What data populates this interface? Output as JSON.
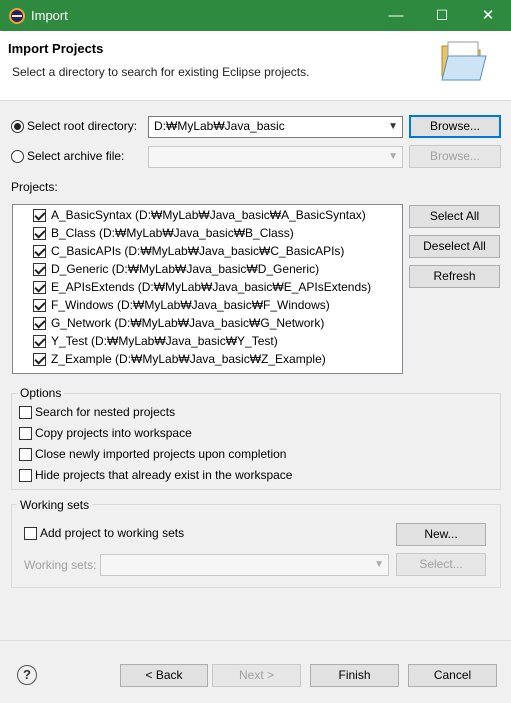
{
  "window": {
    "title": "Import",
    "controls": [
      "—",
      "☐",
      "✕"
    ]
  },
  "header": {
    "title": "Import Projects",
    "description": "Select a directory to search for existing Eclipse projects."
  },
  "source": {
    "root_label": "Select root directory:",
    "root_value": "D:₩MyLab₩Java_basic",
    "archive_label": "Select archive file:",
    "archive_value": "",
    "browse_label": "Browse...",
    "browse_archive_label": "Browse..."
  },
  "projects": {
    "label": "Projects:",
    "items": [
      "A_BasicSyntax (D:₩MyLab₩Java_basic₩A_BasicSyntax)",
      "B_Class (D:₩MyLab₩Java_basic₩B_Class)",
      "C_BasicAPIs (D:₩MyLab₩Java_basic₩C_BasicAPIs)",
      "D_Generic (D:₩MyLab₩Java_basic₩D_Generic)",
      "E_APIsExtends (D:₩MyLab₩Java_basic₩E_APIsExtends)",
      "F_Windows (D:₩MyLab₩Java_basic₩F_Windows)",
      "G_Network (D:₩MyLab₩Java_basic₩G_Network)",
      "Y_Test (D:₩MyLab₩Java_basic₩Y_Test)",
      "Z_Example (D:₩MyLab₩Java_basic₩Z_Example)"
    ],
    "select_all": "Select All",
    "deselect_all": "Deselect All",
    "refresh": "Refresh"
  },
  "options": {
    "label": "Options",
    "items": [
      "Search for nested projects",
      "Copy projects into workspace",
      "Close newly imported projects upon completion",
      "Hide projects that already exist in the workspace"
    ]
  },
  "working_sets": {
    "label": "Working sets",
    "add_label": "Add project to working sets",
    "new_button": "New...",
    "sets_label": "Working sets:",
    "select_button": "Select..."
  },
  "footer": {
    "help": "?",
    "back": "< Back",
    "next": "Next >",
    "finish": "Finish",
    "cancel": "Cancel"
  }
}
